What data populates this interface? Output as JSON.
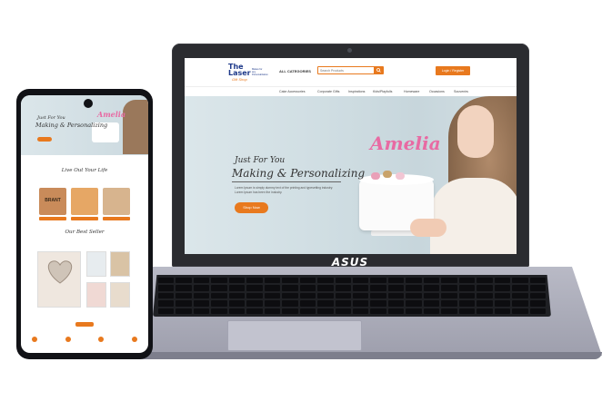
{
  "laptop": {
    "brand": "ASUS"
  },
  "site": {
    "logo": {
      "main": "The Laser",
      "sub": "Gift Shop",
      "tagline": "Makes for any Personalization"
    },
    "header": {
      "all_categories": "ALL CATEGORIES",
      "search_placeholder": "Search Products",
      "login_label": "Login / Register"
    },
    "nav": [
      "Cake Accessories",
      "Corporate Gifts",
      "Inspirations",
      "Kids/Playfulls",
      "Homeware",
      "Occasions",
      "Souvenirs"
    ],
    "hero": {
      "title_line1": "Just For You",
      "title_line2": "Making & Personalizing",
      "description": "Lorem Ipsum is simply dummy text of the printing and typesetting industry. Lorem Ipsum has been the industry.",
      "cta": "Shop Now",
      "topper_text": "Amelia"
    }
  },
  "phone": {
    "hero_line1": "Just For You",
    "hero_line2": "Making & Personalizing",
    "topper_text": "Amelia",
    "section1_title": "Live Out Your Life",
    "section2_title": "Our Best Seller",
    "card_text": "BRANT"
  },
  "colors": {
    "accent": "#e8791e",
    "brand_blue": "#1f3a8a",
    "topper_pink": "#e86aa3"
  }
}
